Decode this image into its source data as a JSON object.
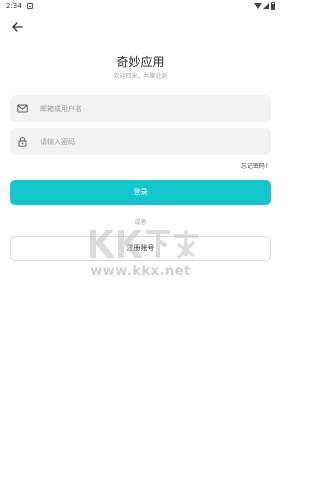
{
  "status_bar": {
    "time": "2:34"
  },
  "app": {
    "title": "奇妙应用",
    "subtitle": "欢迎回来，共聚此刻"
  },
  "form": {
    "username_placeholder": "邮箱或用户名",
    "password_placeholder": "请输入密码",
    "forgot_label": "忘记密码?",
    "login_label": "登录",
    "or_label": "或者",
    "register_label": "注册账号"
  },
  "watermark": {
    "logo_text": "KK下载",
    "url": "www.kkx.net"
  },
  "colors": {
    "accent": "#14c7cd"
  }
}
